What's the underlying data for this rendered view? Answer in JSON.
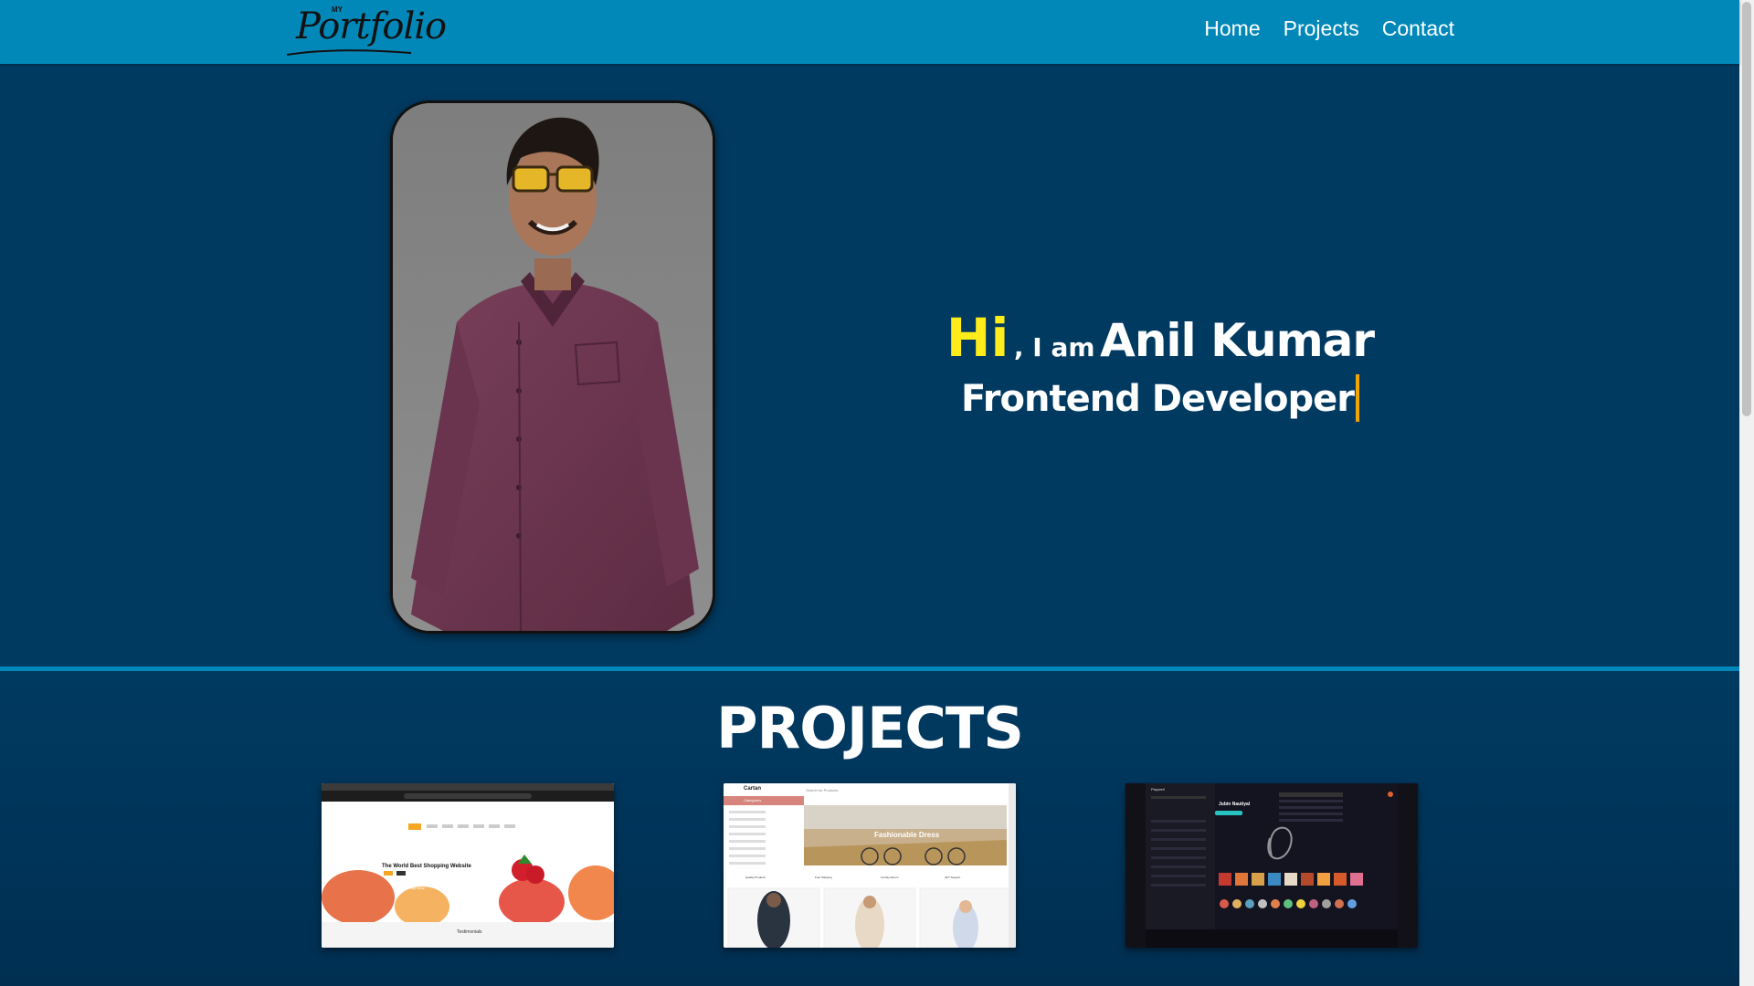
{
  "header": {
    "logo_small": "MY",
    "logo_text": "Portfolio",
    "nav": [
      {
        "label": "Home"
      },
      {
        "label": "Projects"
      },
      {
        "label": "Contact"
      }
    ]
  },
  "hero": {
    "hi": "Hi",
    "i_am": ", I am",
    "name": "Anil Kumar",
    "role": "Frontend Developer"
  },
  "projects": {
    "title": "PROJECTS",
    "cards": [
      {
        "headline": "The World Best Shopping Website",
        "button": "Shop Now",
        "footer": "Testimonials"
      },
      {
        "brand": "Cartan",
        "search": "Search for Products",
        "sidebar_title": "Categories",
        "banner": "Fashionable Dress",
        "features": [
          "Quality Products",
          "Free Shipping",
          "14-Day Return",
          "24/7 Support"
        ]
      },
      {
        "brand": "Playwell",
        "artist": "Jubin Nautiyal"
      }
    ]
  },
  "colors": {
    "header_bg": "#0188b8",
    "page_bg": "#003a61",
    "hi": "#ffec1a",
    "caret": "#f0a500"
  }
}
